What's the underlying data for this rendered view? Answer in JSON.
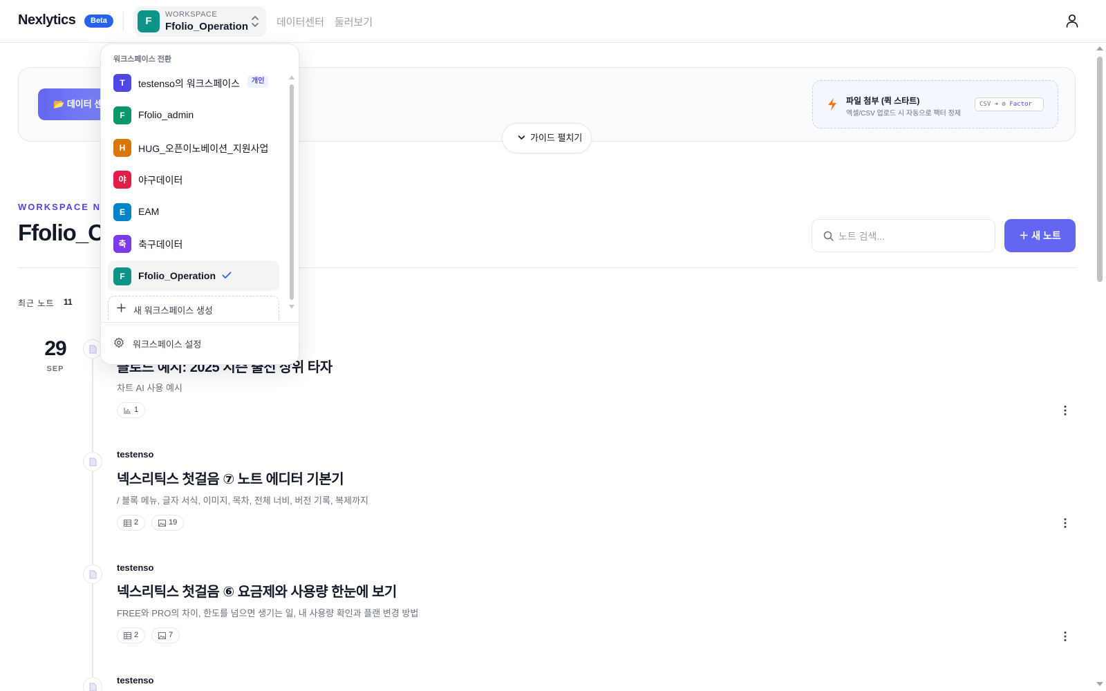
{
  "header": {
    "brand": "Nexlytics",
    "beta": "Beta",
    "workspace_caption": "WORKSPACE",
    "workspace_name": "Ffolio_Operation",
    "workspace_initial": "F",
    "nav": [
      "데이터센터",
      "둘러보기"
    ]
  },
  "guide": {
    "data_button": "데이터 센",
    "quick_title": "파일 첨부 (퀵 스타트)",
    "quick_sub": "엑셀/CSV 업로드 시 자동으로 팩터 정제",
    "tag_csv": "CSV",
    "tag_arrow": "➔",
    "tag_factor": "Factor",
    "toggle": "가이드 펼치기"
  },
  "notebook": {
    "eyebrow": "WORKSPACE NO",
    "title": "Ffolio_O",
    "search_placeholder": "노트 검색...",
    "new_note": "새 노트",
    "recent_label": "최근 노트",
    "recent_count": "11"
  },
  "timeline": {
    "date_day": "29",
    "date_month": "SEP",
    "notes": [
      {
        "author": "",
        "title": "클로드 예시: 2025 시즌 출전 상위 타자",
        "desc": "차트 AI 사용 예시",
        "chips": [
          {
            "icon": "chart-icon",
            "count": "1"
          }
        ]
      },
      {
        "author": "testenso",
        "title": "넥스리틱스 첫걸음 ⑦ 노트 에디터 기본기",
        "desc": "/ 블록 메뉴, 글자 서식, 이미지, 목차, 전체 너비, 버전 기록, 복제까지",
        "chips": [
          {
            "icon": "table-icon",
            "count": "2"
          },
          {
            "icon": "image-icon",
            "count": "19"
          }
        ]
      },
      {
        "author": "testenso",
        "title": "넥스리틱스 첫걸음 ⑥ 요금제와 사용량 한눈에 보기",
        "desc": "FREE와 PRO의 차이, 한도를 넘으면 생기는 일, 내 사용량 확인과 플랜 변경 방법",
        "chips": [
          {
            "icon": "table-icon",
            "count": "2"
          },
          {
            "icon": "image-icon",
            "count": "7"
          }
        ]
      },
      {
        "author": "testenso",
        "title": "",
        "desc": "",
        "chips": []
      }
    ]
  },
  "dropdown": {
    "heading": "워크스페이스 전환",
    "items": [
      {
        "initial": "T",
        "label": "testenso의 워크스페이스",
        "color": "#4f46e5",
        "tag": "개인"
      },
      {
        "initial": "F",
        "label": "Ffolio_admin",
        "color": "#059669"
      },
      {
        "initial": "H",
        "label": "HUG_오픈이노베이션_지원사업",
        "color": "#d97706"
      },
      {
        "initial": "야",
        "label": "야구데이터",
        "color": "#e11d48"
      },
      {
        "initial": "E",
        "label": "EAM",
        "color": "#0284c7"
      },
      {
        "initial": "축",
        "label": "축구데이터",
        "color": "#7c3aed"
      },
      {
        "initial": "F",
        "label": "Ffolio_Operation",
        "color": "#0d9488",
        "active": true
      }
    ],
    "create": "새 워크스페이스 생성",
    "settings": "워크스페이스 설정"
  },
  "colors": {
    "accent": "#6366f1",
    "beta": "#2563eb",
    "workspace": "#0d9488"
  }
}
